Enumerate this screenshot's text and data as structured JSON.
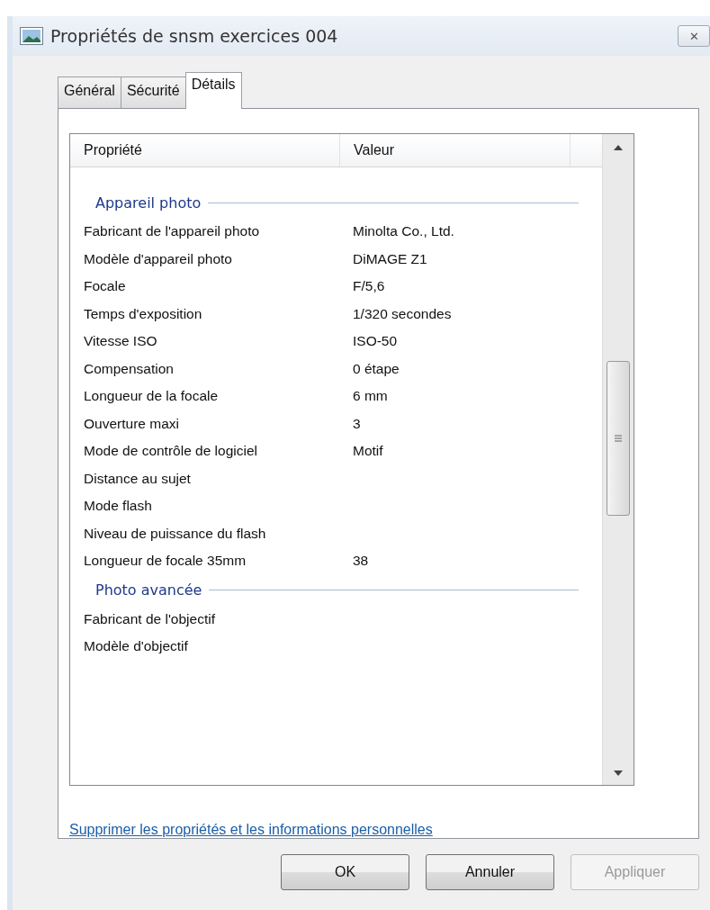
{
  "window": {
    "title": "Propriétés de snsm exercices 004",
    "close": "✕"
  },
  "tabs": [
    {
      "label": "Général",
      "selected": false
    },
    {
      "label": "Sécurité",
      "selected": false
    },
    {
      "label": "Détails",
      "selected": true
    }
  ],
  "table": {
    "columns": [
      "Propriété",
      "Valeur"
    ],
    "groups": [
      {
        "title": "Appareil photo",
        "rows": [
          {
            "name": "Fabricant de l'appareil photo",
            "value": "Minolta Co., Ltd."
          },
          {
            "name": "Modèle d'appareil photo",
            "value": "DiMAGE Z1"
          },
          {
            "name": "Focale",
            "value": "F/5,6"
          },
          {
            "name": "Temps d'exposition",
            "value": "1/320 secondes"
          },
          {
            "name": "Vitesse ISO",
            "value": "ISO-50"
          },
          {
            "name": "Compensation",
            "value": "0 étape"
          },
          {
            "name": "Longueur de la focale",
            "value": "6 mm"
          },
          {
            "name": "Ouverture maxi",
            "value": "3"
          },
          {
            "name": "Mode de contrôle de logiciel",
            "value": "Motif"
          },
          {
            "name": "Distance au sujet"
          },
          {
            "name": "Mode flash"
          },
          {
            "name": "Niveau de puissance du flash"
          },
          {
            "name": "Longueur de focale 35mm",
            "value": "38"
          }
        ]
      },
      {
        "title": "Photo avancée",
        "rows": [
          {
            "name": "Fabricant de l'objectif"
          },
          {
            "name": "Modèle d'objectif"
          }
        ]
      }
    ]
  },
  "link": "Supprimer les propriétés et les informations personnelles",
  "buttons": [
    {
      "label": "OK",
      "disabled": false
    },
    {
      "label": "Annuler",
      "disabled": false
    },
    {
      "label": "Appliquer",
      "disabled": true
    }
  ]
}
